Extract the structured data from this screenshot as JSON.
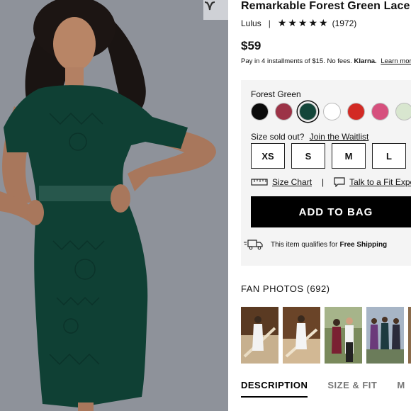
{
  "product": {
    "title": "Remarkable Forest Green Lace Midi Dress",
    "brand": "Lulus",
    "rating_stars": "★★★★★",
    "review_count": "(1972)",
    "price": "$59",
    "installment_text": "Pay in 4 installments of $15. No fees.",
    "klarna_label": "Klarna.",
    "learn_more": "Learn more"
  },
  "options": {
    "color_name": "Forest Green",
    "swatches": [
      {
        "name": "black",
        "color": "#0b0b0b"
      },
      {
        "name": "wine",
        "color": "#9c3347"
      },
      {
        "name": "forest-green",
        "color": "#14463a",
        "selected": true
      },
      {
        "name": "white",
        "color": "#ffffff"
      },
      {
        "name": "red",
        "color": "#d22a24"
      },
      {
        "name": "pink",
        "color": "#d6507d"
      },
      {
        "name": "sage",
        "color": "#d8e6cf"
      }
    ],
    "size_question": "Size sold out?",
    "waitlist_link": "Join the Waitlist",
    "sizes": [
      "XS",
      "S",
      "M",
      "L"
    ],
    "size_chart_label": "Size Chart",
    "fit_expert_label": "Talk to a Fit Expert",
    "add_to_bag": "ADD TO BAG",
    "shipping_text": "This item qualifies for",
    "shipping_bold": "Free Shipping"
  },
  "fan_photos": {
    "label": "FAN PHOTOS (692)"
  },
  "tabs": [
    "DESCRIPTION",
    "SIZE & FIT",
    "M"
  ],
  "icons": {
    "favorite": "heart-v-icon",
    "ruler": "ruler-icon",
    "chat": "chat-bubble-icon",
    "truck": "truck-icon"
  }
}
